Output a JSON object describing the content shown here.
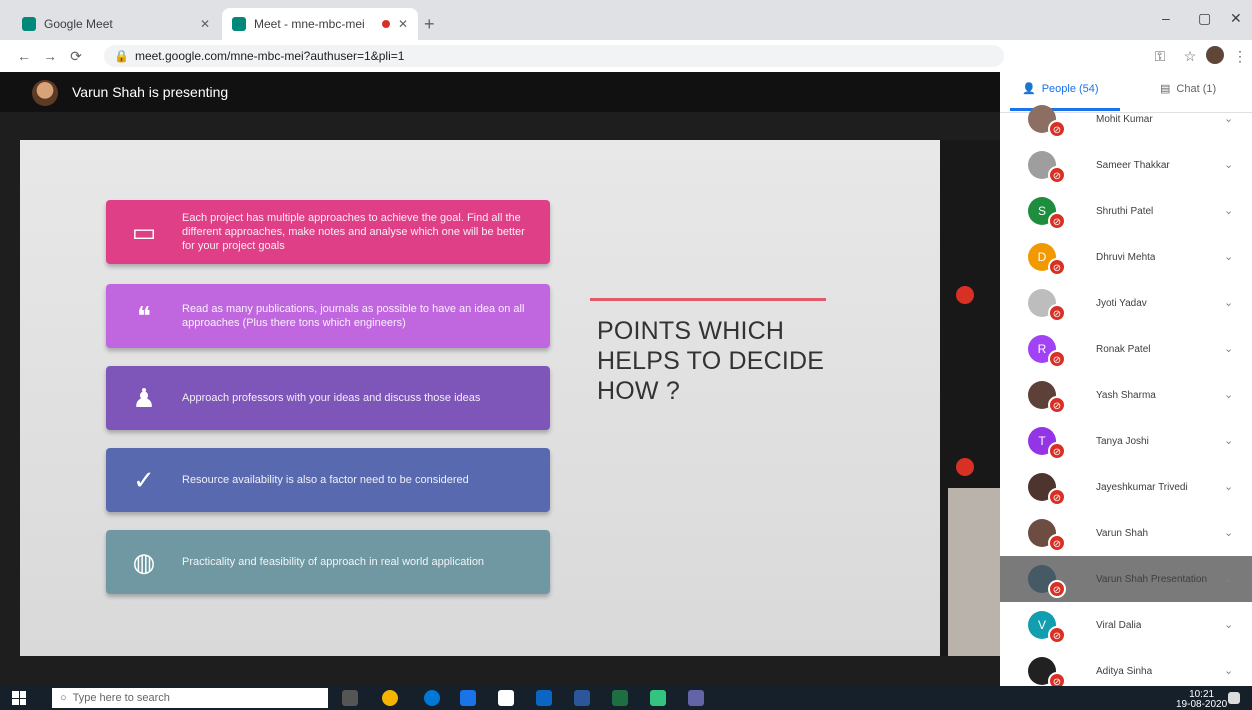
{
  "browser": {
    "tabs": [
      {
        "title": "Google Meet",
        "active": false
      },
      {
        "title": "Meet - mne-mbc-mei",
        "active": true
      }
    ],
    "new_tab": "+",
    "window_controls": [
      "–",
      "▢",
      "✕"
    ],
    "url": "meet.google.com/mne-mbc-mei?authuser=1&pli=1"
  },
  "meet": {
    "presenter_text": "Varun Shah is presenting",
    "slide": {
      "cards": [
        {
          "icon": "monitor-icon",
          "glyph": "🖥",
          "color": "#de3f86",
          "text": "Each project has multiple approaches to achieve the goal. Find all the different approaches, make notes and analyse which one will be better for your project goals"
        },
        {
          "icon": "quote-icon",
          "glyph": "❝",
          "color": "#c067e0",
          "text": "Read as many publications, journals as possible to have an idea on all approaches (Plus there tons which engineers)"
        },
        {
          "icon": "people-icon",
          "glyph": "👥",
          "color": "#7e55b8",
          "text": "Approach professors with your ideas and discuss those ideas"
        },
        {
          "icon": "check-icon",
          "glyph": "✓",
          "color": "#5969b0",
          "text": "Resource availability is also a factor need to be considered"
        },
        {
          "icon": "globe-icon",
          "glyph": "🌍",
          "color": "#6f98a3",
          "text": "Practicality and feasibility of approach in real world application"
        }
      ],
      "heading": "POINTS WHICH HELPS TO DECIDE HOW ?"
    }
  },
  "panel": {
    "tab_people": "People (54)",
    "tab_chat": "Chat (1)",
    "participants": [
      {
        "name": "Mohit Kumar",
        "initial": "",
        "color": "#8d6e63"
      },
      {
        "name": "Sameer Thakkar",
        "initial": "",
        "color": "#9e9e9e"
      },
      {
        "name": "Shruthi Patel",
        "initial": "S",
        "color": "#1e8e3e"
      },
      {
        "name": "Dhruvi Mehta",
        "initial": "D",
        "color": "#f29900"
      },
      {
        "name": "Jyoti Yadav",
        "initial": "",
        "color": "#bdbdbd"
      },
      {
        "name": "Ronak Patel",
        "initial": "R",
        "color": "#a142f4"
      },
      {
        "name": "Yash Sharma",
        "initial": "",
        "color": "#5d4037"
      },
      {
        "name": "Tanya Joshi",
        "initial": "T",
        "color": "#9334e6"
      },
      {
        "name": "Jayeshkumar Trivedi",
        "initial": "",
        "color": "#4e342e"
      },
      {
        "name": "Varun Shah",
        "initial": "",
        "color": "#6d4c41"
      },
      {
        "name": "Varun Shah Presentation",
        "initial": "",
        "color": "#455a64"
      },
      {
        "name": "Viral Dalia",
        "initial": "V",
        "color": "#129eaf"
      },
      {
        "name": "Aditya Sinha",
        "initial": "",
        "color": "#212121"
      }
    ]
  },
  "taskbar": {
    "search_placeholder": "Type here to search",
    "time": "10:21",
    "date": "19-08-2020"
  }
}
